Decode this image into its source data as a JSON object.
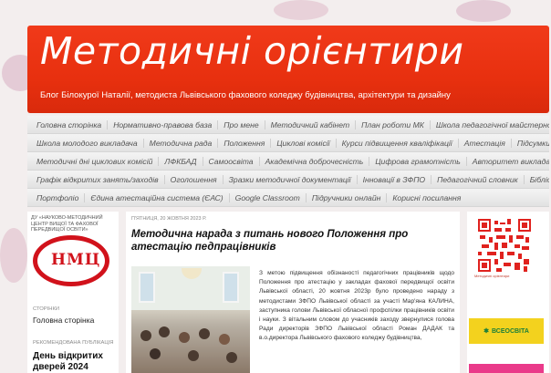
{
  "header": {
    "title": "Методичні орієнтири",
    "subtitle": "Блог Білокурої Наталії, методиста Львівського фахового коледжу будівництва, архітектури та дизайну"
  },
  "nav": {
    "rows": [
      [
        "Головна сторінка",
        "Нормативно-правова база",
        "Про мене",
        "Методичний кабінет",
        "План роботи МК",
        "Школа педагогічної майстерності"
      ],
      [
        "Школа молодого викладача",
        "Методична рада",
        "Положення",
        "Циклові комісії",
        "Курси підвищення кваліфікації",
        "Атестація",
        "Підсумки МР"
      ],
      [
        "Методичні дні циклових комісій",
        "ЛФКБАД",
        "Самоосвіта",
        "Академічна доброчесність",
        "Цифрова грамотність",
        "Авторитет викладача"
      ],
      [
        "Графік відкритих занять/заходів",
        "Оголошення",
        "Зразки методичної документації",
        "Інновації в ЗФПО",
        "Педагогічний словник",
        "Бібліотека"
      ],
      [
        "Портфоліо",
        "Єдина атестаційна система (ЄАС)",
        "Google Classroom",
        "Підручники онлайн",
        "Корисні посилання"
      ]
    ]
  },
  "sidebar_left": {
    "org_caption": "ДУ «НАУКОВО-МЕТОДИЧНИЙ ЦЕНТР ВИЩОЇ ТА ФАХОВОЇ ПЕРЕДВИЩОЇ ОСВІТИ»",
    "logo_text": "НМЦ",
    "pages_heading": "СТОРІНКИ",
    "pages_link": "Головна сторінка",
    "recommended_heading": "РЕКОМЕНДОВАНА ПУБЛІКАЦІЯ",
    "recommended_title": "День відкритих дверей 2024"
  },
  "post": {
    "date": "П'ЯТНИЦЯ, 20 ЖОВТНЯ 2023 Р.",
    "title": "Методична нарада з питань нового Положення про атестацію педпрацівників",
    "body": "З метою підвищення обізнаності педагогічних працівників щодо Положення про атестацію у закладах фахової передвищої освіти Львівської області, 20 жовтня 2023р було проведено нараду з методистами ЗФПО Львівської області за участі Мар'яна КАЛИНА, заступника голови Львівської обласної профспілки працівників освіти і науки. З вітальним словом до учасників заходу звернулися голова Ради директорів ЗФПО Львівської області Роман ДАДАК та в.о.директора Львівського фахового коледжу будівництва,"
  },
  "sidebar_right": {
    "qr_caption": "Методичні орієнтири",
    "badge_text": "ВСЕОСВІТА"
  },
  "colors": {
    "header": "#e8300f",
    "logo_red": "#d1121b"
  }
}
